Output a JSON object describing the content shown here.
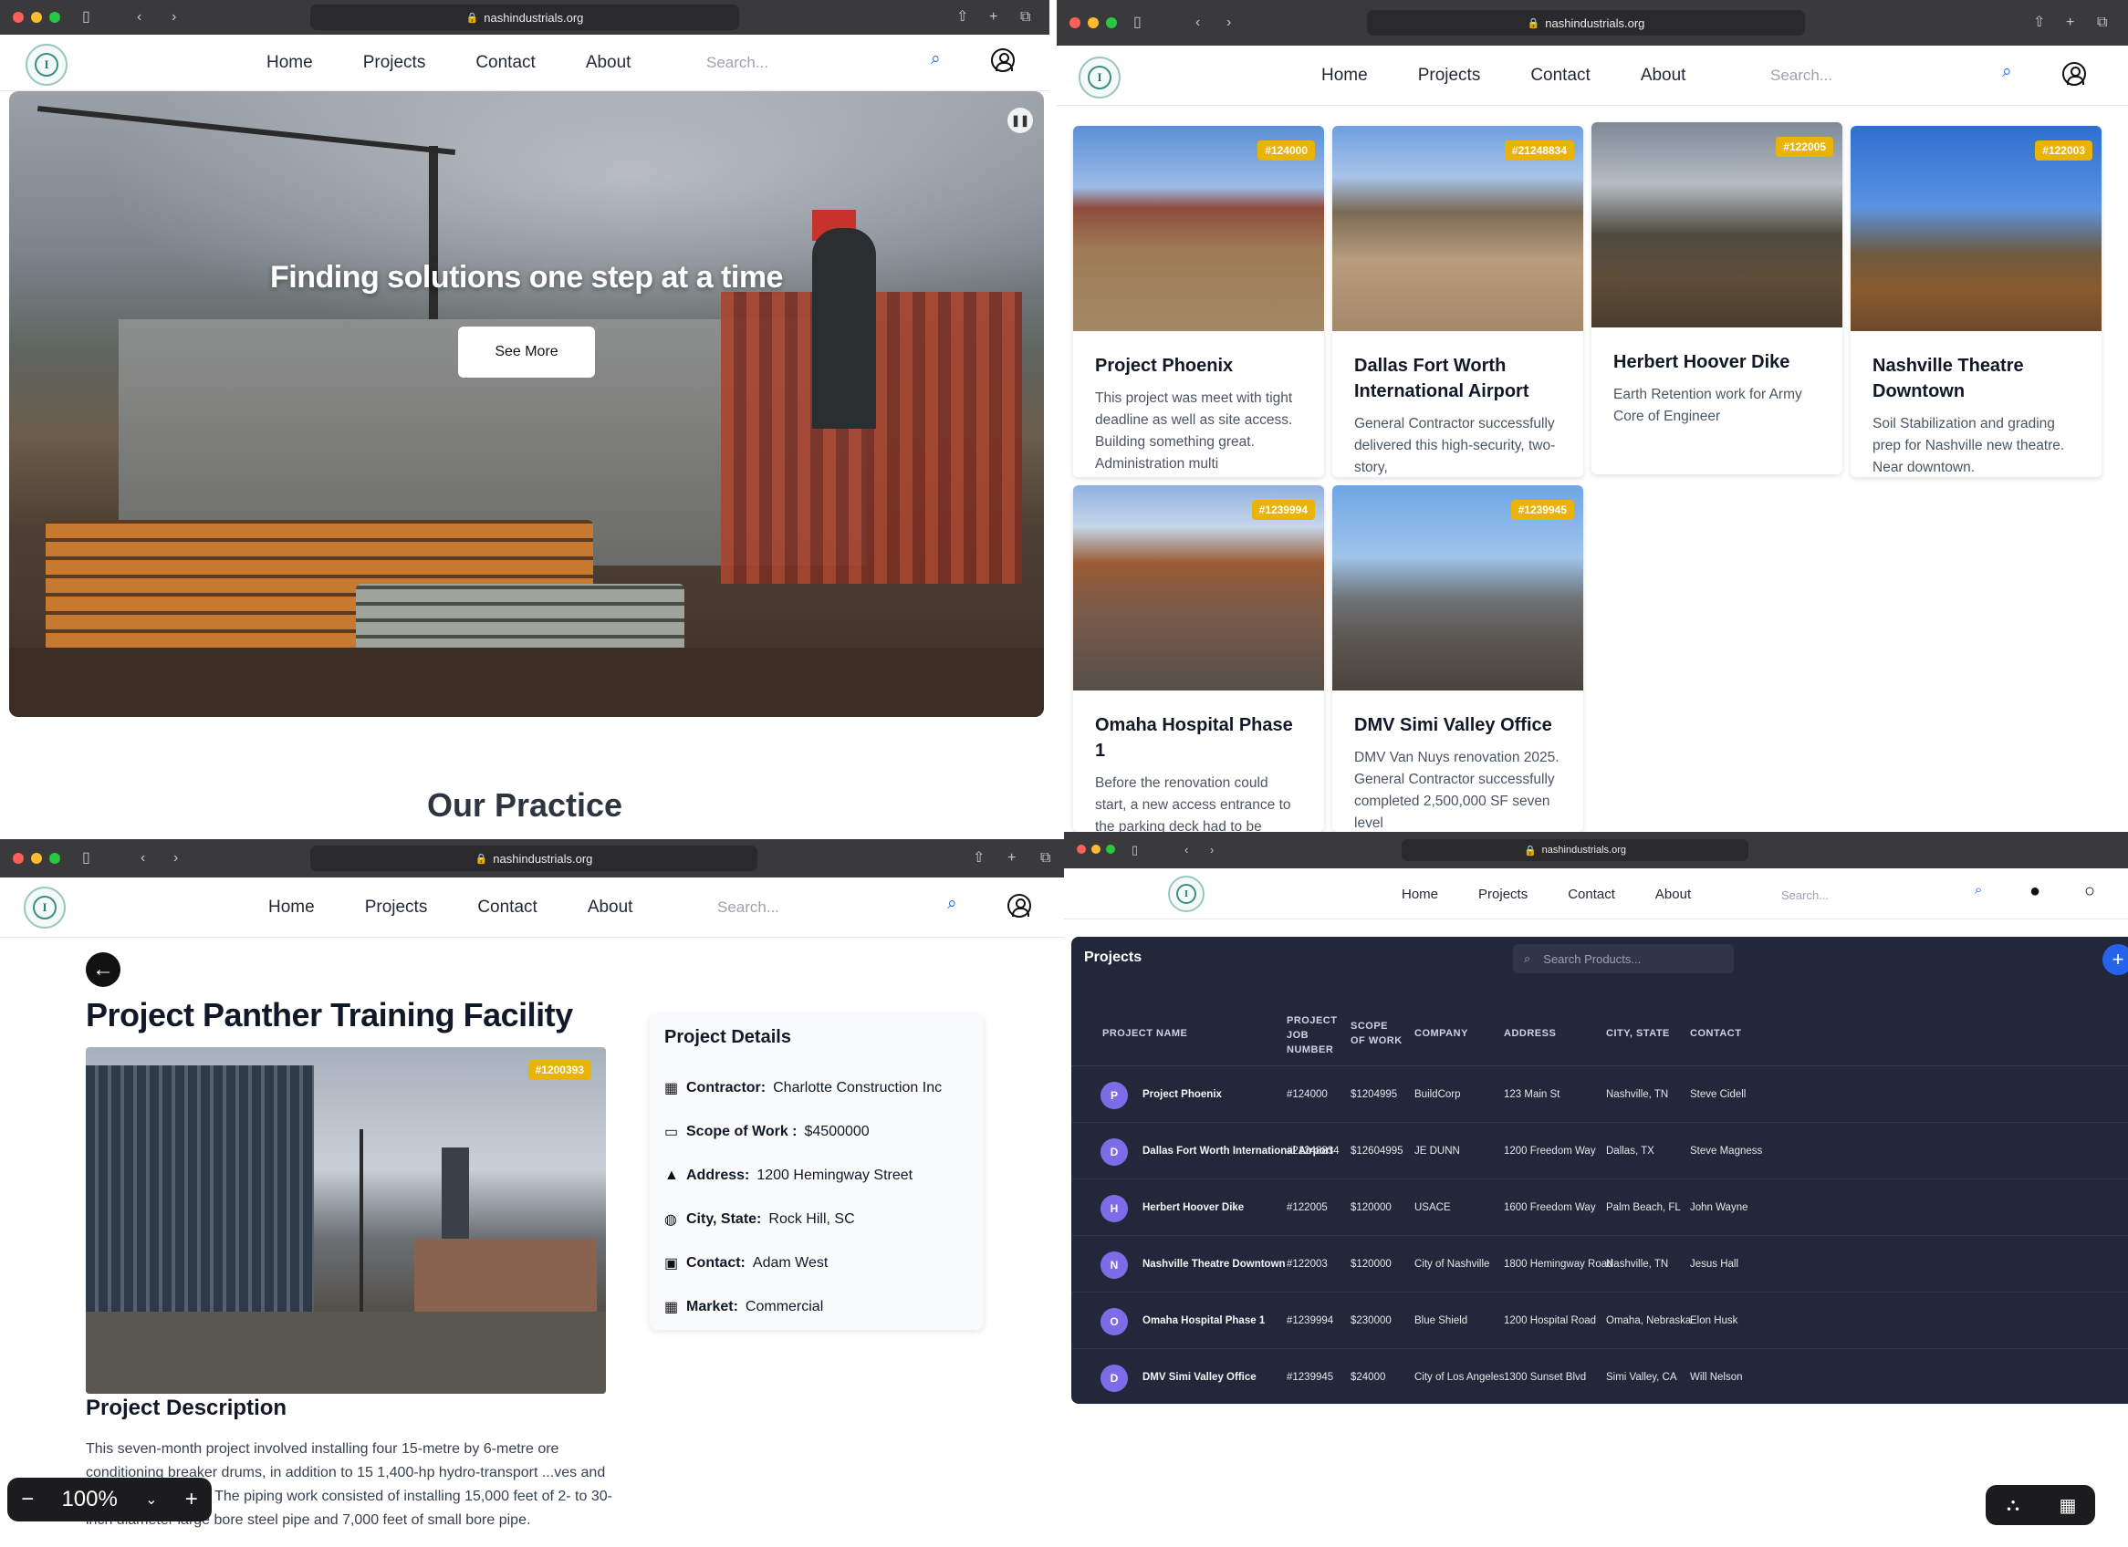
{
  "browser": {
    "url": "nashindustrials.org"
  },
  "nav": {
    "logo_letter": "I",
    "links": [
      "Home",
      "Projects",
      "Contact",
      "About"
    ],
    "search_placeholder": "Search..."
  },
  "home": {
    "hero_title": "Finding solutions one step at a time",
    "hero_button": "See More",
    "section_title": "Our Practice"
  },
  "grid": {
    "cards": [
      {
        "badge": "#124000",
        "title": "Project Phoenix",
        "text": "This project was meet with tight deadline as well as site access. Building something great. Administration multi"
      },
      {
        "badge": "#21248834",
        "title": "Dallas Fort Worth International Airport",
        "text": "General Contractor successfully delivered this high-security, two-story,"
      },
      {
        "badge": "#122005",
        "title": "Herbert Hoover Dike",
        "text": "Earth Retention work for Army Core of Engineer"
      },
      {
        "badge": "#122003",
        "title": "Nashville Theatre Downtown",
        "text": "Soil Stabilization and grading prep for Nashville new theatre. Near downtown."
      },
      {
        "badge": "#1239994",
        "title": "Omaha Hospital Phase 1",
        "text": "Before the renovation could start, a new access entrance to the parking deck had to be constructed, and the flow of"
      },
      {
        "badge": "#1239945",
        "title": "DMV Simi Valley Office",
        "text": "DMV Van Nuys renovation 2025. General Contractor successfully completed 2,500,000 SF seven level"
      }
    ]
  },
  "detail": {
    "title": "Project Panther Training Facility",
    "badge": "#1200393",
    "description_title": "Project Description",
    "description": "This seven-month project involved installing four 15-metre by 6-metre ore conditioning breaker drums, in addition to 15 1,400-hp hydro-transport ...ves and support equipment. The piping work consisted of installing 15,000 feet of 2- to 30-inch diameter large bore steel pipe and 7,000 feet of small bore pipe.",
    "panel_title": "Project Details",
    "fields": [
      {
        "key": "Contractor:",
        "value": "Charlotte Construction Inc"
      },
      {
        "key": "Scope of Work :",
        "value": "$4500000"
      },
      {
        "key": "Address:",
        "value": "1200 Hemingway Street"
      },
      {
        "key": "City, State:",
        "value": "Rock Hill, SC"
      },
      {
        "key": "Contact:",
        "value": "Adam West"
      },
      {
        "key": "Market:",
        "value": "Commercial"
      }
    ],
    "zoom": "100%"
  },
  "table": {
    "title": "Projects",
    "search_placeholder": "Search Products...",
    "headers": [
      "Project Name",
      "Project Job Number",
      "Scope of Work",
      "Company",
      "Address",
      "City, State",
      "Contact"
    ],
    "rows": [
      {
        "initial": "P",
        "name": "Project Phoenix",
        "job": "#124000",
        "scope": "$1204995",
        "company": "BuildCorp",
        "address": "123 Main St",
        "city": "Nashville, TN",
        "contact": "Steve Cidell"
      },
      {
        "initial": "D",
        "name": "Dallas Fort Worth International Airport",
        "job": "#21248834",
        "scope": "$12604995",
        "company": "JE DUNN",
        "address": "1200 Freedom Way",
        "city": "Dallas, TX",
        "contact": "Steve Magness"
      },
      {
        "initial": "H",
        "name": "Herbert Hoover Dike",
        "job": "#122005",
        "scope": "$120000",
        "company": "USACE",
        "address": "1600 Freedom Way",
        "city": "Palm Beach, FL",
        "contact": "John Wayne"
      },
      {
        "initial": "N",
        "name": "Nashville Theatre Downtown",
        "job": "#122003",
        "scope": "$120000",
        "company": "City of Nashville",
        "address": "1800 Hemingway Road",
        "city": "Nashville, TN",
        "contact": "Jesus Hall"
      },
      {
        "initial": "O",
        "name": "Omaha Hospital Phase 1",
        "job": "#1239994",
        "scope": "$230000",
        "company": "Blue Shield",
        "address": "1200 Hospital Road",
        "city": "Omaha, Nebraska",
        "contact": "Elon Husk"
      },
      {
        "initial": "D",
        "name": "DMV Simi Valley Office",
        "job": "#1239945",
        "scope": "$24000",
        "company": "City of Los Angeles",
        "address": "1300 Sunset Blvd",
        "city": "Simi Valley, CA",
        "contact": "Will Nelson"
      }
    ]
  },
  "colors": {
    "badge": "#eab308",
    "accent": "#2563eb",
    "table_bg": "#22283a",
    "avatar": "#7c6ce8"
  }
}
